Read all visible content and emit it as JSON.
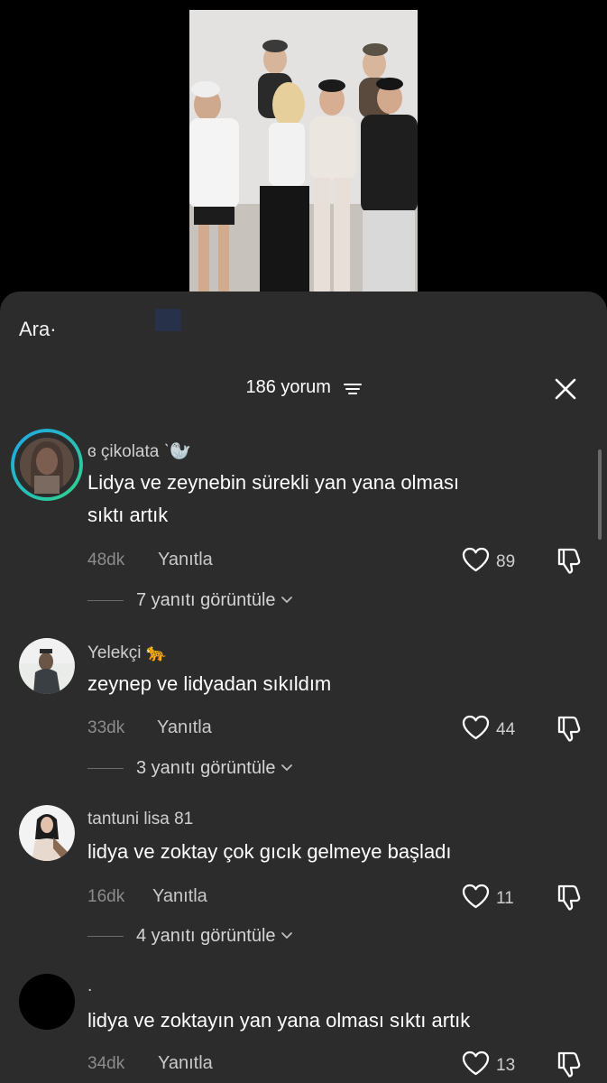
{
  "search": {
    "label": "Ara·"
  },
  "header": {
    "count_label": "186 yorum"
  },
  "comments": [
    {
      "username": "ɞ çikolata ˋ🦭",
      "text_lines": [
        "Lidya ve zeynebin sürekli yan yana olması",
        "sıktı artık"
      ],
      "time": "48dk",
      "reply_label": "Yanıtla",
      "likes": "89",
      "replies_label": "7 yanıtı görüntüle"
    },
    {
      "username": "Yelekçi 🐆",
      "text_lines": [
        "zeynep ve lidyadan sıkıldım"
      ],
      "time": "33dk",
      "reply_label": "Yanıtla",
      "likes": "44",
      "replies_label": "3 yanıtı görüntüle"
    },
    {
      "username": "tantuni lisa 81",
      "text_lines": [
        "lidya ve zoktay çok gıcık gelmeye başladı"
      ],
      "time": "16dk",
      "reply_label": "Yanıtla",
      "likes": "11",
      "replies_label": "4 yanıtı görüntüle"
    },
    {
      "username": ".",
      "text_lines": [
        "lidya ve zoktayın yan yana olması sıktı artık"
      ],
      "time": "34dk",
      "reply_label": "Yanıtla",
      "likes": "13"
    }
  ],
  "icons": {
    "filter": "filter-lines-icon",
    "close": "close-icon",
    "like": "heart-outline-icon",
    "dislike": "thumbs-down-icon",
    "chevron": "chevron-down-icon"
  },
  "colors": {
    "sheet_bg": "#2c2c2c",
    "story_ring_start": "#1ea7e8",
    "story_ring_end": "#2fd48a"
  }
}
